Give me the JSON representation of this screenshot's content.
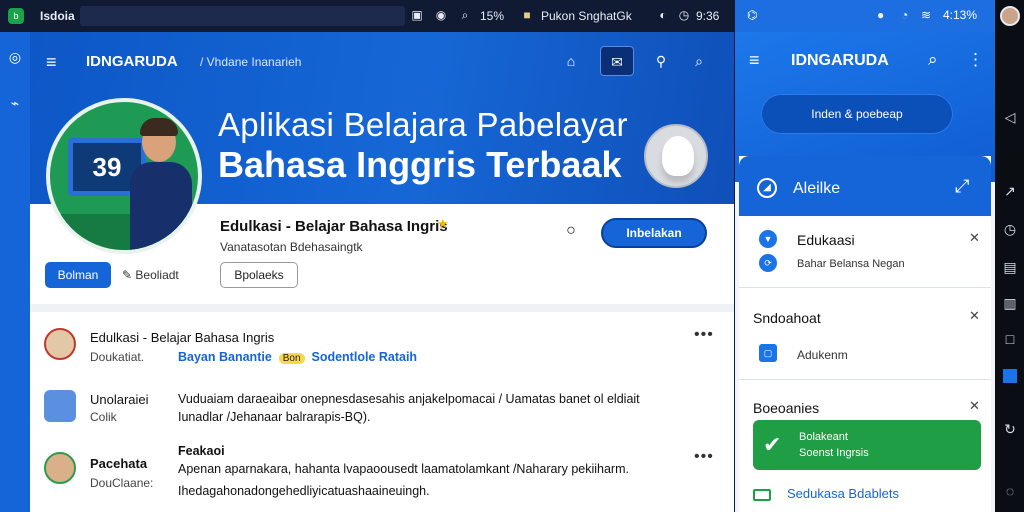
{
  "status_bar": {
    "app_title": "Isdoia",
    "battery_text": "15%",
    "tab_title": "Pukon SnghatGk",
    "time_text": "9:36"
  },
  "main": {
    "brand": "IDNGARUDA",
    "brand_sub": "/ Vhdane Inanarieh",
    "hero_line1": "Aplikasi Belajara Pabelayar",
    "hero_line2": "Bahasa Inggris Terbaak",
    "avatar_screen_text": "39",
    "profile_name": "Edulkasi - Belajar Bahasa Ingris",
    "profile_tagline": "Vanatasotan Bdehasaingtk",
    "cta_label": "Inbelakan",
    "primary_button": "Bolman",
    "link_label": "Beoliadt",
    "outline_button": "Bpolaeks",
    "posts": [
      {
        "title": "Edulkasi - Belajar Bahasa Ingris",
        "meta": "Doukatiat.",
        "link1": "Bayan Banantie",
        "chip": "Bon",
        "link2": "Sodentlole Rataih"
      },
      {
        "title": "Unolaraiei",
        "meta": "Colik",
        "body1": "Vuduaiam daraeaibar onepnesdasesahis anjakelpomacai / Uamatas banet ol eldiait",
        "body2": "Iunadlar /Jehanaar balrarapis-BQ)."
      },
      {
        "title": "Pacehata",
        "meta": "DouClaane:",
        "heading": "Feakaoi",
        "body1": "Apenan aparnakara, hahanta lvapaoousedt laamatolamkant /Naharary pekiiharm.",
        "body2": "Ihedagahonadongehedliyicatuashaaineuingh."
      }
    ]
  },
  "phone": {
    "time": "4:13%",
    "brand": "IDNGARUDA",
    "pill_label": "Inden & poebeap",
    "card_title": "Aleilke",
    "sections": [
      {
        "title": "Edukaasi",
        "subtitle": "Bahar Belansa Negan"
      },
      {
        "header": "Sndoahoat",
        "item": "Adukenm"
      },
      {
        "header": "Boeoanies"
      }
    ],
    "green_line1": "Bolakeant",
    "green_line2": "Soenst Ingrsis",
    "last_row": "Sedukasa Bdablets"
  },
  "colors": {
    "brand_blue": "#1565d8",
    "accent_green": "#1f9e45",
    "badge_yellow": "#f8d84a"
  }
}
